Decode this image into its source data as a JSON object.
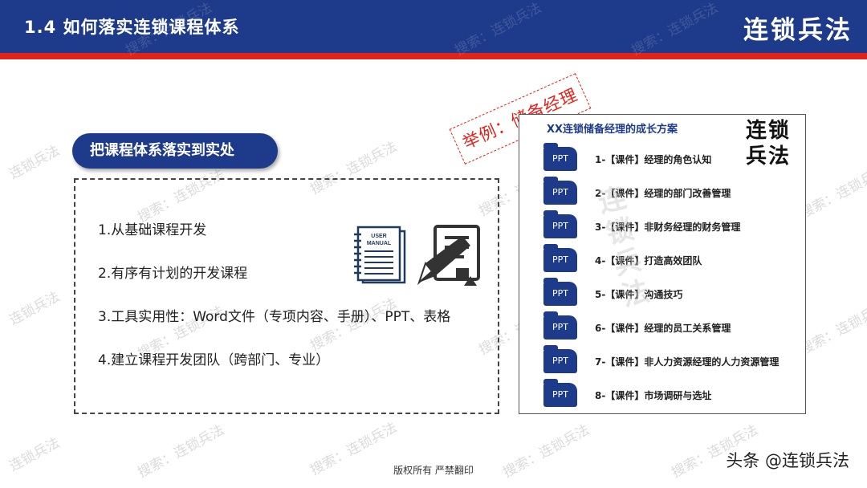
{
  "header": {
    "title": "1.4  如何落实连锁课程体系",
    "brand": "连锁兵法"
  },
  "watermark_text": "搜索：连锁兵法",
  "watermark_short": "连锁兵法",
  "section_pill": "把课程体系落实到实处",
  "points": [
    "1.从基础课程开发",
    "2.有序有计划的开发课程",
    "3.工具实用性：Word文件（专项内容、手册）、PPT、表格",
    "4.建立课程开发团队（跨部门、专业）"
  ],
  "manual_icon": {
    "line1": "USER",
    "line2": "MANUAL"
  },
  "stamp": "举例：储备经理",
  "panel": {
    "title": "XX连锁储备经理的成长方案",
    "brand": "连锁兵法",
    "file_label": "PPT",
    "items": [
      "1-【课件】经理的角色认知",
      "2-【课件】经理的部门改善管理",
      "3-【课件】非财务经理的财务管理",
      "4-【课件】打造高效团队",
      "5-【课件】沟通技巧",
      "6-【课件】经理的员工关系管理",
      "7-【课件】非人力资源经理的人力资源管理",
      "8-【课件】市场调研与选址"
    ]
  },
  "footer": "版权所有 严禁翻印",
  "credit": "头条 @连锁兵法",
  "colors": {
    "navy": "#1e3a8a",
    "red": "#e2231a"
  }
}
